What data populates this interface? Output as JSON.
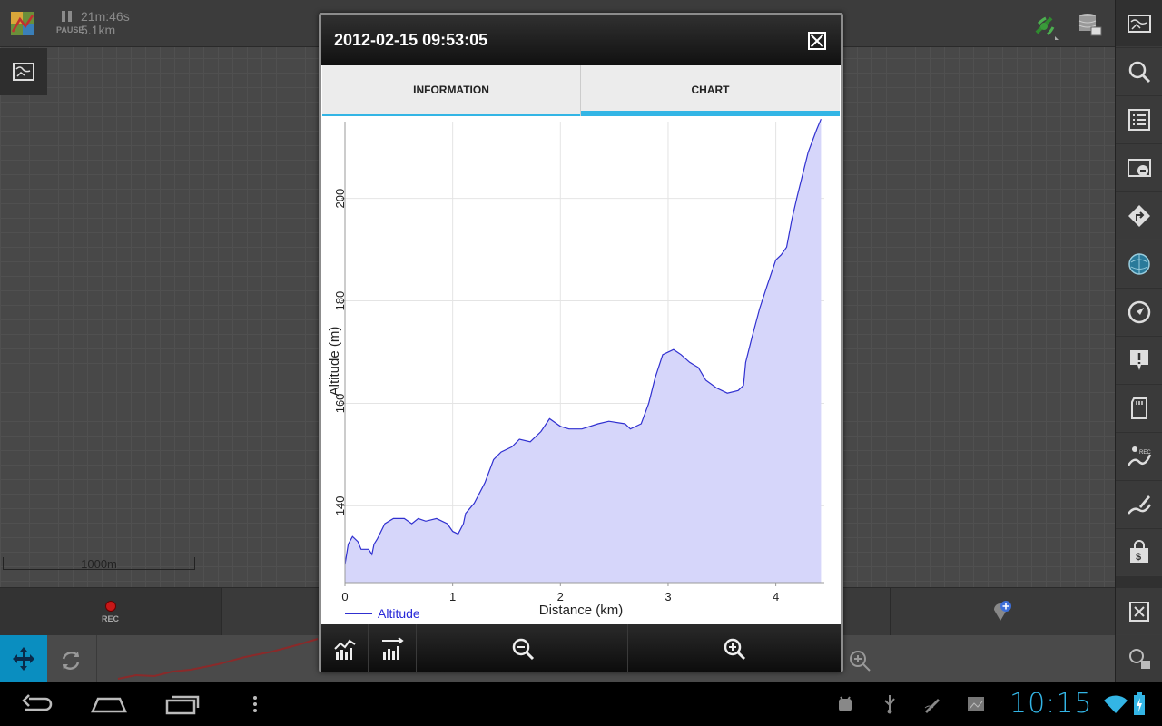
{
  "status": {
    "pause_label": "PAUSE",
    "elapsed": "21m:46s",
    "distance": "5.1km"
  },
  "map": {
    "scale_label": "1000m",
    "rec_label": "REC"
  },
  "dialog": {
    "title": "2012-02-15 09:53:05",
    "tabs": [
      {
        "label": "INFORMATION",
        "selected": false
      },
      {
        "label": "CHART",
        "selected": true
      }
    ],
    "legend_label": "Altitude"
  },
  "chart_data": {
    "type": "area",
    "xlabel": "Distance (km)",
    "ylabel": "Altitude (m)",
    "xlim": [
      0,
      4.45
    ],
    "ylim": [
      125,
      215
    ],
    "x_ticks": [
      "0",
      "1",
      "2",
      "3",
      "4"
    ],
    "y_ticks": [
      "140",
      "160",
      "180",
      "200"
    ],
    "grid": true,
    "legend_placement": "bottom-left",
    "series": [
      {
        "name": "Altitude",
        "color": "#3030d0",
        "fill": "#d6d6fa",
        "x": [
          0,
          0.03,
          0.07,
          0.12,
          0.15,
          0.22,
          0.25,
          0.27,
          0.3,
          0.37,
          0.45,
          0.55,
          0.62,
          0.68,
          0.75,
          0.85,
          0.95,
          1.0,
          1.05,
          1.1,
          1.12,
          1.2,
          1.3,
          1.38,
          1.45,
          1.55,
          1.62,
          1.72,
          1.82,
          1.9,
          2.0,
          2.08,
          2.2,
          2.35,
          2.45,
          2.6,
          2.65,
          2.75,
          2.82,
          2.88,
          2.95,
          3.05,
          3.12,
          3.2,
          3.28,
          3.35,
          3.45,
          3.55,
          3.65,
          3.7,
          3.72,
          3.78,
          3.85,
          3.92,
          4.0,
          4.05,
          4.1,
          4.15,
          4.2,
          4.3,
          4.38,
          4.42
        ],
        "y": [
          128.5,
          132.5,
          134,
          133,
          131.5,
          131.5,
          130.5,
          132.5,
          133.5,
          136.5,
          137.5,
          137.5,
          136.5,
          137.5,
          137,
          137.5,
          136.5,
          135,
          134.5,
          136.5,
          138.5,
          140.5,
          144.5,
          149,
          150.5,
          151.5,
          153,
          152.5,
          154.5,
          157,
          155.5,
          155,
          155,
          156,
          156.5,
          156,
          155,
          156,
          160,
          165,
          169.5,
          170.5,
          169.5,
          168,
          167,
          164.5,
          163,
          162,
          162.5,
          163.5,
          168,
          173,
          178.5,
          183,
          188,
          189,
          190.5,
          196,
          200.5,
          209,
          213.5,
          215.5
        ]
      }
    ]
  }
}
